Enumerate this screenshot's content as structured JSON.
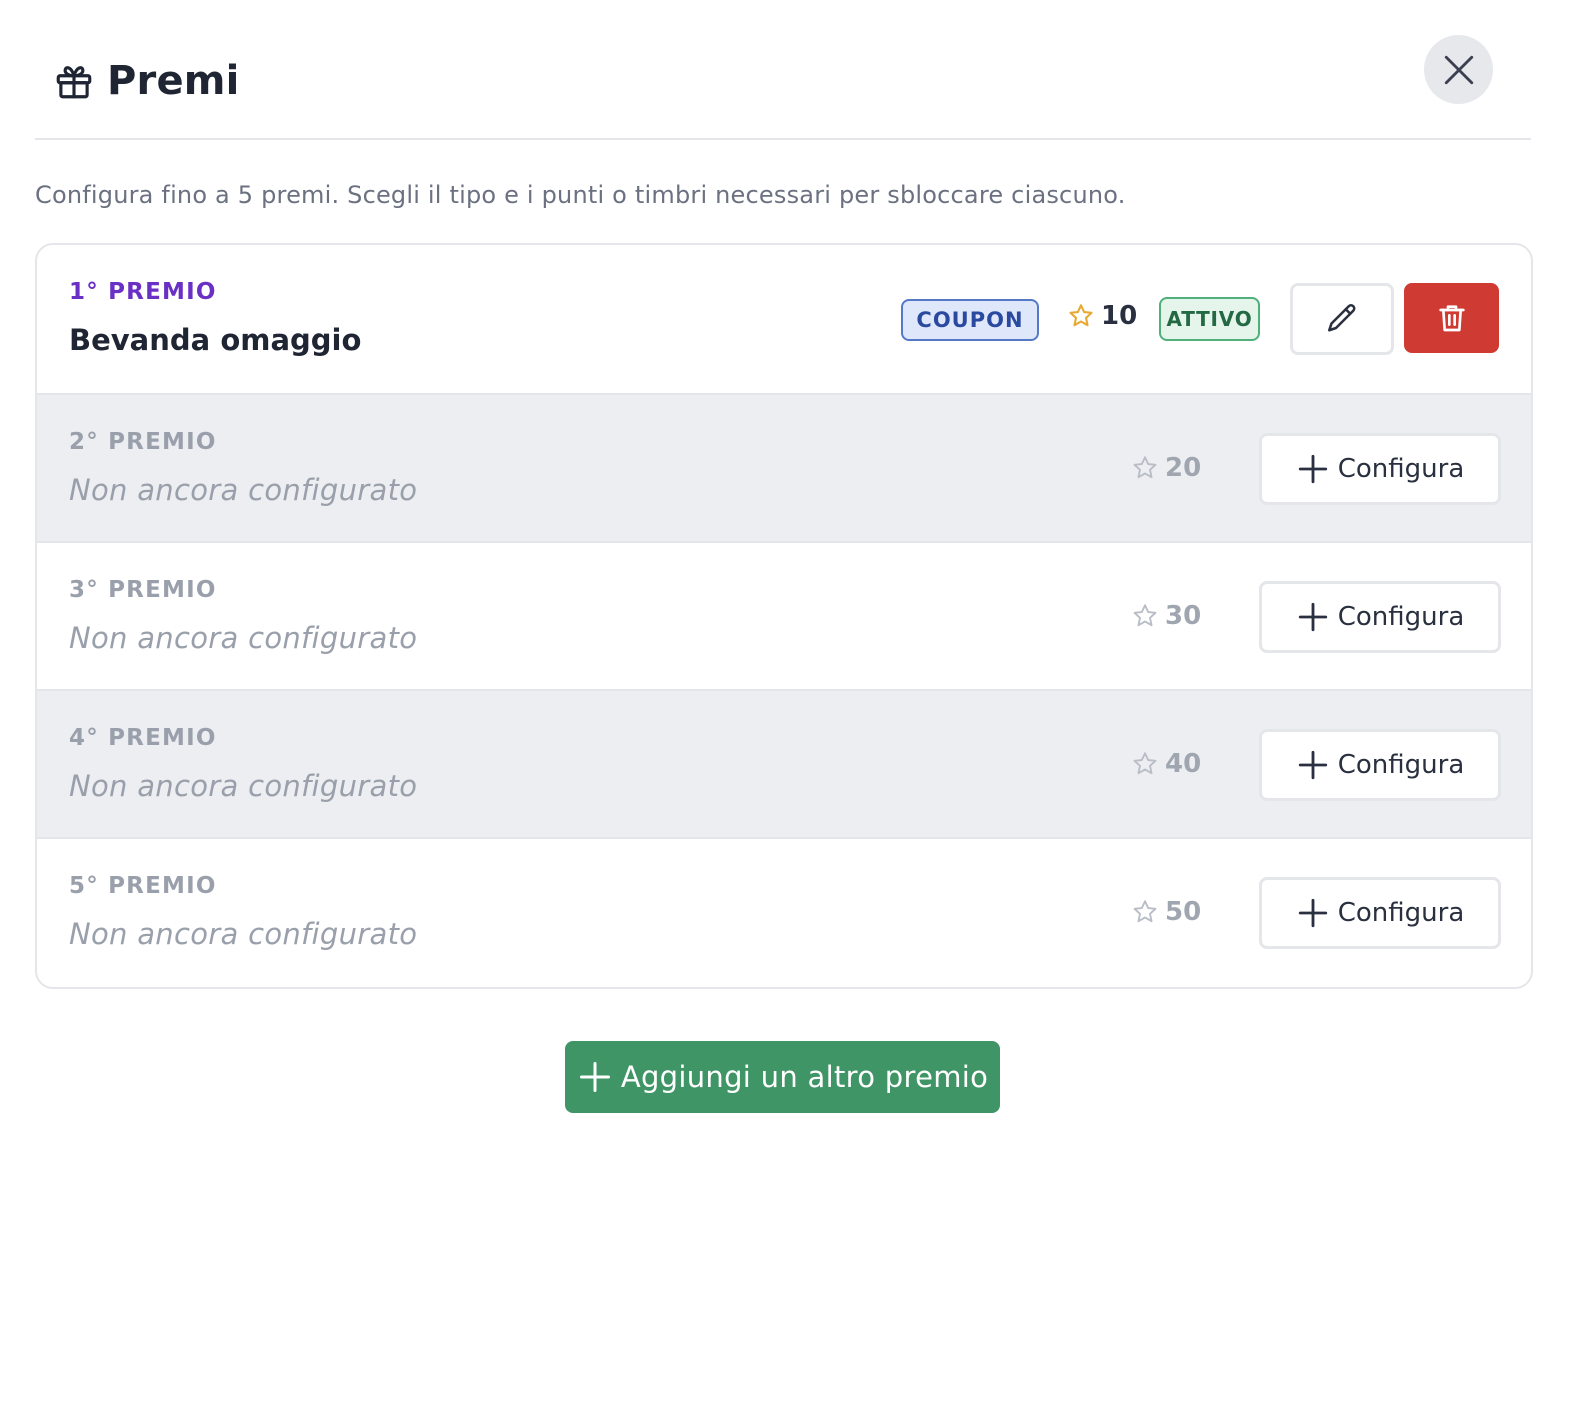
{
  "header": {
    "title": "Premi",
    "icon": "gift-icon",
    "close_icon": "close-icon"
  },
  "description": "Configura fino a 5 premi. Scegli il tipo e i punti o timbri necessari per sbloccare ciascuno.",
  "prizes": [
    {
      "rank": "1° PREMIO",
      "name": "Bevanda omaggio",
      "type_badge": "COUPON",
      "points": "10",
      "status": "ATTIVO",
      "configured": true
    },
    {
      "rank": "2° PREMIO",
      "placeholder": "Non ancora configurato",
      "points": "20",
      "action_label": "Configura",
      "configured": false
    },
    {
      "rank": "3° PREMIO",
      "placeholder": "Non ancora configurato",
      "points": "30",
      "action_label": "Configura",
      "configured": false
    },
    {
      "rank": "4° PREMIO",
      "placeholder": "Non ancora configurato",
      "points": "40",
      "action_label": "Configura",
      "configured": false
    },
    {
      "rank": "5° PREMIO",
      "placeholder": "Non ancora configurato",
      "points": "50",
      "action_label": "Configura",
      "configured": false
    }
  ],
  "add_button": {
    "label": "Aggiungi un altro premio"
  },
  "colors": {
    "accent_purple": "#6a2fc4",
    "coupon_blue": "#2a4aa0",
    "active_green": "#226944",
    "delete_red": "#cf3a33",
    "add_green": "#3f9566",
    "star_gold": "#e8a834"
  }
}
